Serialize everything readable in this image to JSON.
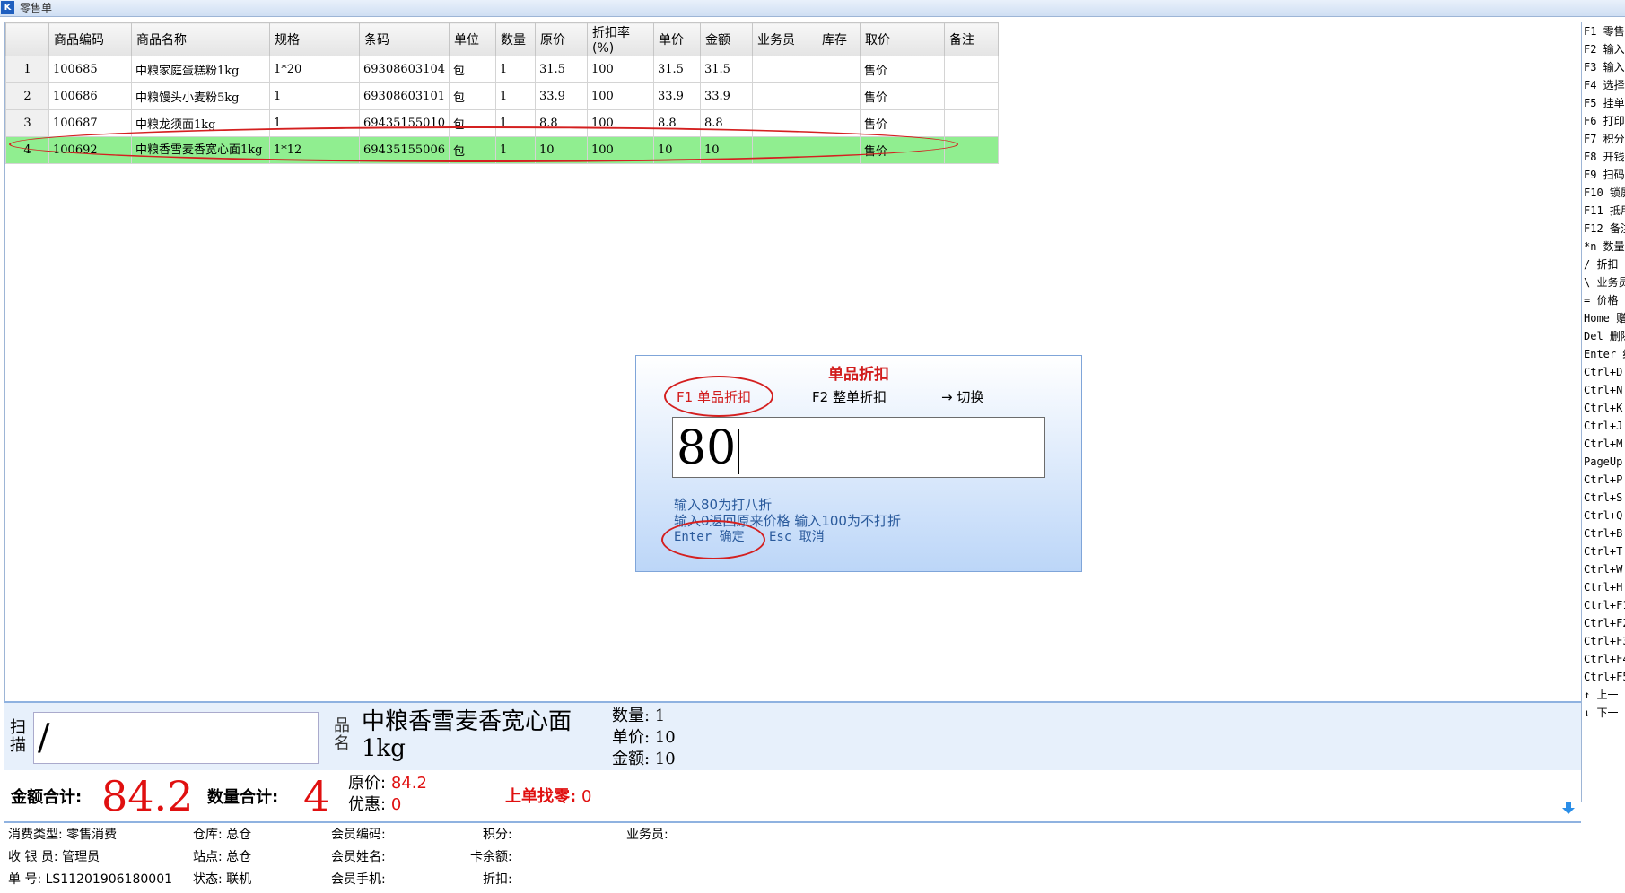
{
  "window": {
    "title": "零售单"
  },
  "grid": {
    "columns": [
      "",
      "商品编码",
      "商品名称",
      "规格",
      "条码",
      "单位",
      "数量",
      "原价",
      "折扣率(%)",
      "单价",
      "金额",
      "业务员",
      "库存",
      "取价",
      "备注"
    ],
    "rows": [
      {
        "idx": "1",
        "code": "100685",
        "name": "中粮家庭蛋糕粉1kg",
        "spec": "1*20",
        "barcode": "69308603104",
        "unit": "包",
        "qty": "1",
        "orig": "31.5",
        "rate": "100",
        "price": "31.5",
        "amount": "31.5",
        "clerk": "",
        "stock": "",
        "pricing": "售价",
        "note": ""
      },
      {
        "idx": "2",
        "code": "100686",
        "name": "中粮馒头小麦粉5kg",
        "spec": "1",
        "barcode": "69308603101",
        "unit": "包",
        "qty": "1",
        "orig": "33.9",
        "rate": "100",
        "price": "33.9",
        "amount": "33.9",
        "clerk": "",
        "stock": "",
        "pricing": "售价",
        "note": ""
      },
      {
        "idx": "3",
        "code": "100687",
        "name": "中粮龙须面1kg",
        "spec": "1",
        "barcode": "69435155010",
        "unit": "包",
        "qty": "1",
        "orig": "8.8",
        "rate": "100",
        "price": "8.8",
        "amount": "8.8",
        "clerk": "",
        "stock": "",
        "pricing": "售价",
        "note": ""
      },
      {
        "idx": "4",
        "code": "100692",
        "name": "中粮香雪麦香宽心面1kg",
        "spec": "1*12",
        "barcode": "69435155006",
        "unit": "包",
        "qty": "1",
        "orig": "10",
        "rate": "100",
        "price": "10",
        "amount": "10",
        "clerk": "",
        "stock": "",
        "pricing": "售价",
        "note": ""
      }
    ]
  },
  "shortcuts": [
    "F1 零售",
    "F2 输入",
    "F3 输入",
    "F4 选择",
    "F5 挂单",
    "F6 打印",
    "F7 积分",
    "F8 开钱",
    "F9 扫码",
    "F10 锁屏",
    "F11 抵用",
    "F12 备注",
    "*n 数量",
    "/ 折扣",
    "\\ 业务员",
    "= 价格",
    "Home 赠",
    "Del 删除",
    "Enter 结",
    "Ctrl+D",
    "Ctrl+N",
    "Ctrl+K",
    "Ctrl+J",
    "Ctrl+M",
    "PageUp",
    "Ctrl+P",
    "Ctrl+S",
    "Ctrl+Q",
    "Ctrl+B",
    "Ctrl+T",
    "Ctrl+W",
    "Ctrl+H",
    "Ctrl+F1",
    "Ctrl+F2",
    "Ctrl+F3",
    "Ctrl+F4",
    "Ctrl+F5",
    "↑ 上一",
    "↓ 下一"
  ],
  "dialog": {
    "title": "单品折扣",
    "opt_single": "F1 单品折扣",
    "opt_whole": "F2 整单折扣",
    "opt_switch": "→ 切换",
    "input_value": "80",
    "hint1": "输入80为打八折",
    "hint2": "输入0返回原来价格  输入100为不打折",
    "enter": "Enter 确定",
    "esc": "Esc 取消"
  },
  "scan": {
    "label": "扫描",
    "value": "/",
    "name_label": "品名",
    "product_name": "中粮香雪麦香宽心面1kg",
    "qty": "数量: 1",
    "price": "单价: 10",
    "amount": "金额: 10"
  },
  "totals": {
    "amount_label": "金额合计:",
    "amount": "84.2",
    "qty_label": "数量合计:",
    "qty": "4",
    "orig_label": "原价:",
    "orig": "84.2",
    "discount_label": "优惠:",
    "discount": "0",
    "change_label": "上单找零:",
    "change": "0"
  },
  "status": {
    "consume_type": "消费类型: 零售消费",
    "cashier": "收 银 员: 管理员",
    "order_no": "单     号: LS11201906180001",
    "warehouse": "仓库: 总仓",
    "station": "站点: 总仓",
    "state": "状态: 联机",
    "member_code": "会员编码:",
    "member_name": "会员姓名:",
    "member_phone": "会员手机:",
    "points": "积分:",
    "card_balance": "卡余额:",
    "discount": "折扣:",
    "salesman": "业务员:"
  }
}
